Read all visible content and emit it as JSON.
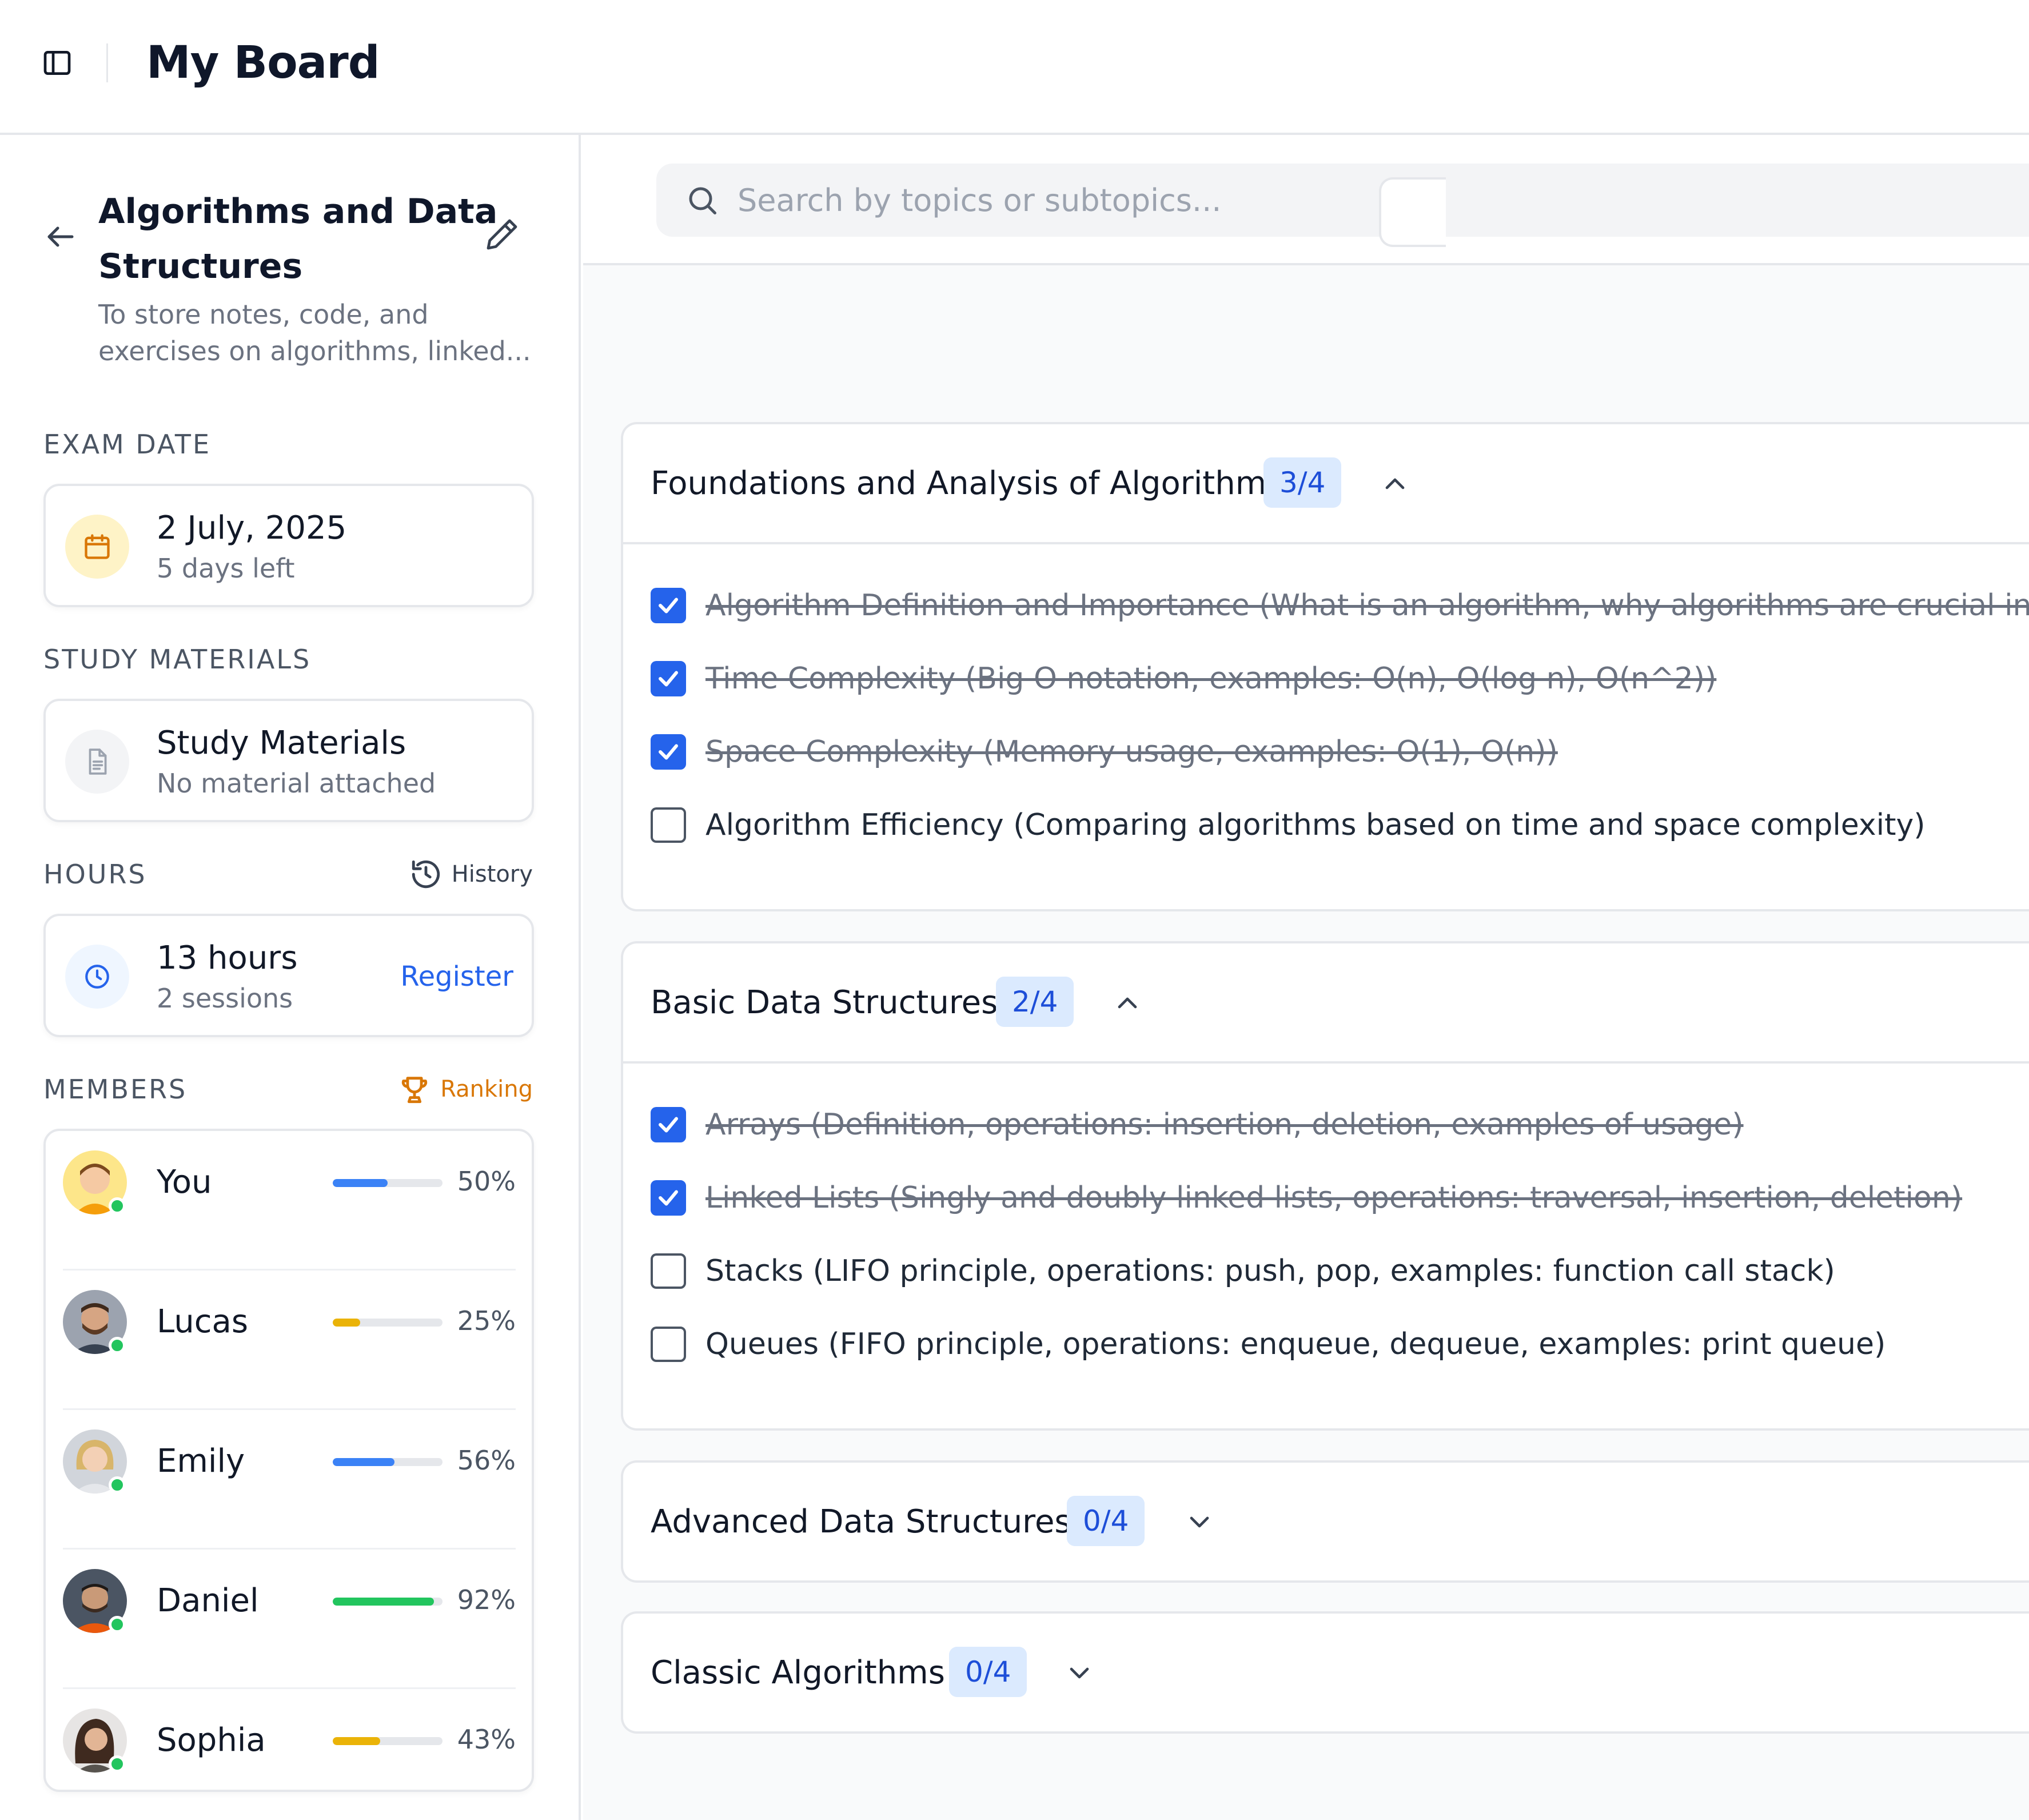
{
  "app": {
    "title": "My Board"
  },
  "board": {
    "title": "Algorithms and Data Structures",
    "description": "To store notes, code, and exercises on algorithms, linked..."
  },
  "exam": {
    "label": "EXAM DATE",
    "date": "2 July, 2025",
    "remaining": "5 days left"
  },
  "materials": {
    "label": "STUDY MATERIALS",
    "title": "Study Materials",
    "status": "No material attached"
  },
  "hours": {
    "label": "HOURS",
    "history_label": "History",
    "total": "13 hours",
    "sessions": "2 sessions",
    "register_label": "Register"
  },
  "members": {
    "label": "MEMBERS",
    "ranking_label": "Ranking",
    "list": [
      {
        "name": "You",
        "percent_label": "50%",
        "progress": 0.5,
        "color": "#3b82f6"
      },
      {
        "name": "Lucas",
        "percent_label": "25%",
        "progress": 0.25,
        "color": "#eab308"
      },
      {
        "name": "Emily",
        "percent_label": "56%",
        "progress": 0.56,
        "color": "#3b82f6"
      },
      {
        "name": "Daniel",
        "percent_label": "92%",
        "progress": 0.92,
        "color": "#22c55e"
      },
      {
        "name": "Sophia",
        "percent_label": "43%",
        "progress": 0.43,
        "color": "#eab308"
      }
    ]
  },
  "search": {
    "placeholder": "Search by topics or subtopics..."
  },
  "topics": [
    {
      "title": "Foundations and Analysis of Algorithms",
      "count": "3/4",
      "expanded": true,
      "items": [
        {
          "text": "Algorithm Definition and Importance (What is an algorithm, why algorithms are crucial in c",
          "done": true
        },
        {
          "text": "Time Complexity (Big O notation, examples: O(n), O(log n), O(n^2))",
          "done": true
        },
        {
          "text": "Space Complexity (Memory usage, examples: O(1), O(n))",
          "done": true
        },
        {
          "text": "Algorithm Efficiency (Comparing algorithms based on time and space complexity)",
          "done": false
        }
      ]
    },
    {
      "title": "Basic Data Structures",
      "count": "2/4",
      "expanded": true,
      "items": [
        {
          "text": "Arrays (Definition, operations: insertion, deletion, examples of usage)",
          "done": true
        },
        {
          "text": "Linked Lists (Singly and doubly linked lists, operations: traversal, insertion, deletion)",
          "done": true
        },
        {
          "text": "Stacks (LIFO principle, operations: push, pop, examples: function call stack)",
          "done": false
        },
        {
          "text": "Queues (FIFO principle, operations: enqueue, dequeue, examples: print queue)",
          "done": false
        }
      ]
    },
    {
      "title": "Advanced Data Structures",
      "count": "0/4",
      "expanded": false,
      "items": []
    },
    {
      "title": "Classic Algorithms",
      "count": "0/4",
      "expanded": false,
      "items": []
    }
  ]
}
